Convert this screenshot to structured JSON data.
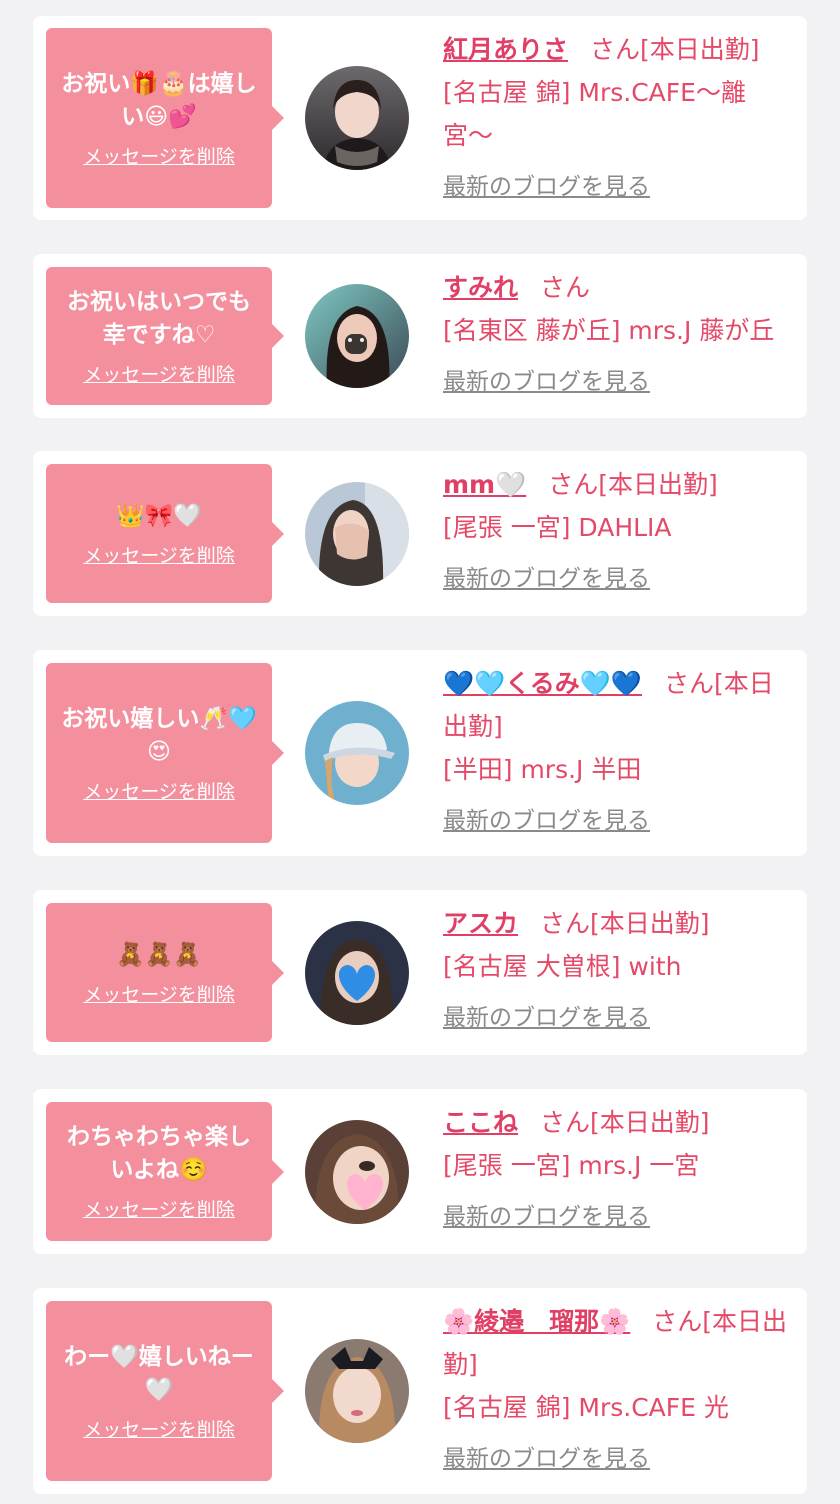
{
  "colors": {
    "page_bg": "#f2f2f4",
    "card_bg": "#ffffff",
    "bubble": "#f4909e",
    "accent": "#e44a68",
    "link_gray": "#8a8a8a"
  },
  "entries": [
    {
      "message": "お祝い🎁🎂は嬉しい😃💕",
      "delete_label": "メッセージを削除",
      "name": "紅月ありさ",
      "suffix": "さん[本日出勤]",
      "shop": "[名古屋 錦] Mrs.CAFE〜離宮〜",
      "blog_label": "最新のブログを見る",
      "avatar": "portrait-dark-hair"
    },
    {
      "message": "お祝いはいつでも幸ですね♡",
      "delete_label": "メッセージを削除",
      "name": "すみれ",
      "suffix": "さん",
      "shop": "[名東区 藤が丘] mrs.J 藤が丘",
      "blog_label": "最新のブログを見る",
      "avatar": "portrait-bear-sticker"
    },
    {
      "message": "👑🎀🤍",
      "delete_label": "メッセージを削除",
      "name": "mm🤍",
      "suffix": "さん[本日出勤]",
      "shop": "[尾張 一宮] DAHLIA",
      "blog_label": "最新のブログを見る",
      "avatar": "portrait-hand-cover"
    },
    {
      "message": "お祝い嬉しい🥂🩵😍",
      "delete_label": "メッセージを削除",
      "name": "💙🩵くるみ🩵💙",
      "suffix": "さん[本日出勤]",
      "shop": "[半田] mrs.J 半田",
      "blog_label": "最新のブログを見る",
      "avatar": "portrait-cap"
    },
    {
      "message": "🧸🧸🧸",
      "delete_label": "メッセージを削除",
      "name": "アスカ",
      "suffix": "さん[本日出勤]",
      "shop": "[名古屋 大曽根] with",
      "blog_label": "最新のブログを見る",
      "avatar": "portrait-blue-heart"
    },
    {
      "message": "わちゃわちゃ楽しいよね☺️",
      "delete_label": "メッセージを削除",
      "name": "ここね",
      "suffix": "さん[本日出勤]",
      "shop": "[尾張 一宮] mrs.J 一宮",
      "blog_label": "最新のブログを見る",
      "avatar": "portrait-pink-heart"
    },
    {
      "message": "わー🤍嬉しいねー🤍",
      "delete_label": "メッセージを削除",
      "name": "🌸綾邉　瑠那🌸",
      "suffix": "さん[本日出勤]",
      "shop": "[名古屋 錦] Mrs.CAFE 光",
      "blog_label": "最新のブログを見る",
      "avatar": "portrait-bow"
    }
  ]
}
